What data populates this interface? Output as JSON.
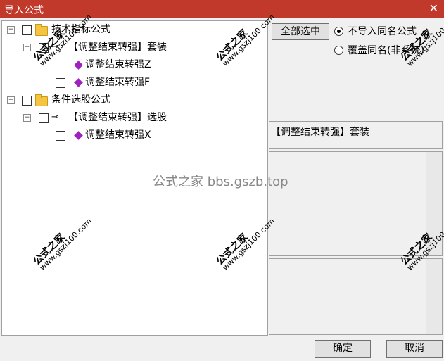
{
  "window": {
    "title": "导入公式",
    "close_glyph": "✕"
  },
  "tree": {
    "group1_label": "技术指标公式",
    "group1_child_label": "【调整结束转强】套装",
    "group1_leaf1": "调整结束转强Z",
    "group1_leaf2": "调整结束转强F",
    "group2_label": "条件选股公式",
    "group2_child_label": "【调整结束转强】选股",
    "group2_leaf1": "调整结束转强X"
  },
  "options": {
    "select_all": "全部选中",
    "radio_no_import": "不导入同名公式",
    "radio_overwrite": "覆盖同名(非系统)"
  },
  "info_text": "【调整结束转强】套装",
  "buttons": {
    "ok": "确定",
    "cancel": "取消"
  },
  "watermark": {
    "brand": "公式之家",
    "url": "www.gszj100.com",
    "center": "公式之家 bbs.gszb.top"
  },
  "colors": {
    "titlebar": "#c0392b",
    "folder": "#f5c542",
    "gem": "#a020c0"
  }
}
